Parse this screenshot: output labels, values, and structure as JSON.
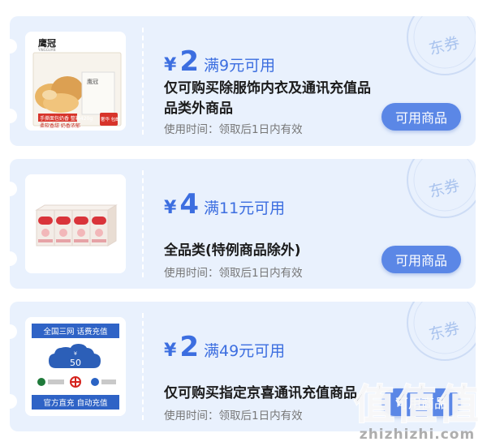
{
  "coupons": [
    {
      "currency": "¥",
      "amount": "2",
      "condition": "满9元可用",
      "description": "仅可购买除服饰内衣及通讯充值品品类外商品",
      "validity": "使用时间：领取后1日内有效",
      "button_label": "可用商品",
      "stamp_label": "东券",
      "product": {
        "brand": "鹰冠",
        "brand_sub": "YINGGUAN",
        "box_text": "手撕面包奶香 整箱420g",
        "box_slogan": "柔软香甜 奶香浓郁",
        "badge": "奢华 包邮"
      }
    },
    {
      "currency": "¥",
      "amount": "4",
      "condition": "满11元可用",
      "description": "全品类(特例商品除外)",
      "validity": "使用时间：领取后1日内有效",
      "button_label": "可用商品",
      "stamp_label": "东券"
    },
    {
      "currency": "¥",
      "amount": "2",
      "condition": "满49元可用",
      "description": "仅可购买指定京喜通讯充值商品",
      "validity": "使用时间：领取后1日内有效",
      "button_label": "可用商品",
      "stamp_label": "东券",
      "product": {
        "top_label": "全国三网 话费充值",
        "face_value": "50",
        "face_currency": "¥",
        "bottom_label": "官方直充 自动充值"
      }
    }
  ],
  "watermark": {
    "logo": "值值值",
    "url": "zhizhizhi.com"
  },
  "colors": {
    "accent": "#3c6ee0",
    "button": "#5b87e6",
    "card_bg": "#e9f1fd"
  }
}
